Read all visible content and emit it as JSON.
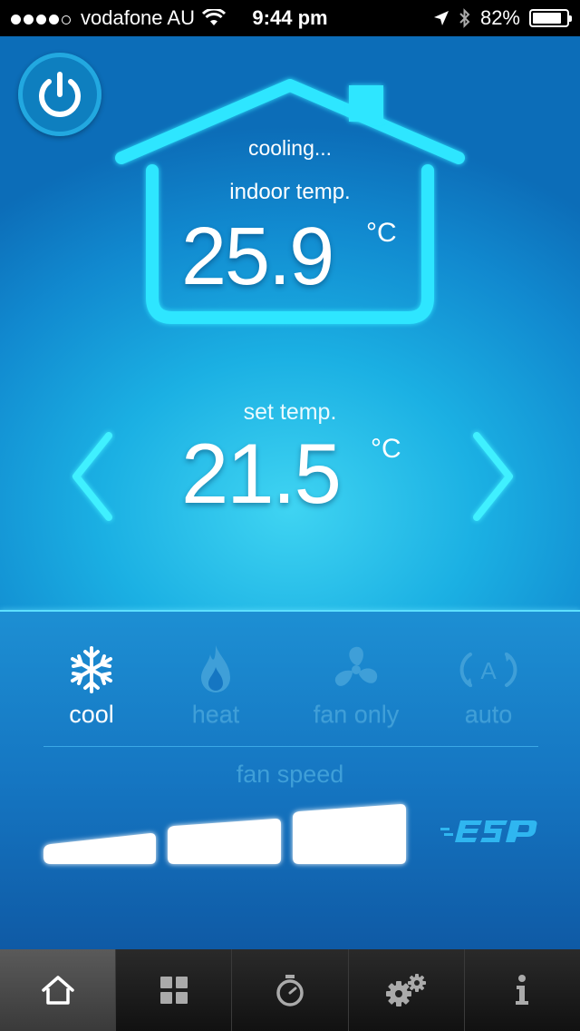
{
  "status_bar": {
    "carrier": "vodafone AU",
    "time": "9:44 pm",
    "battery": "82%",
    "battery_level": 0.82
  },
  "thermostat": {
    "status": "cooling...",
    "indoor_label": "indoor temp.",
    "indoor_temp": "25.9",
    "unit": "°C",
    "set_label": "set temp.",
    "set_temp": "21.5"
  },
  "modes": [
    {
      "label": "cool",
      "icon": "snowflake-icon",
      "active": true
    },
    {
      "label": "heat",
      "icon": "flame-icon",
      "active": false
    },
    {
      "label": "fan only",
      "icon": "fan-icon",
      "active": false
    },
    {
      "label": "auto",
      "icon": "auto-icon",
      "active": false
    }
  ],
  "fan": {
    "label": "fan speed",
    "levels": 3,
    "level": 3
  },
  "brand": "ESP",
  "tabs": [
    {
      "icon": "home-icon",
      "active": true
    },
    {
      "icon": "grid-icon",
      "active": false
    },
    {
      "icon": "timer-icon",
      "active": false
    },
    {
      "icon": "settings-icon",
      "active": false
    },
    {
      "icon": "info-icon",
      "active": false
    }
  ],
  "colors": {
    "accent": "#2fe2ff",
    "inactive": "#3f9fd8",
    "status_bar": "#000000",
    "tab_bar": "#1a1a1a"
  }
}
